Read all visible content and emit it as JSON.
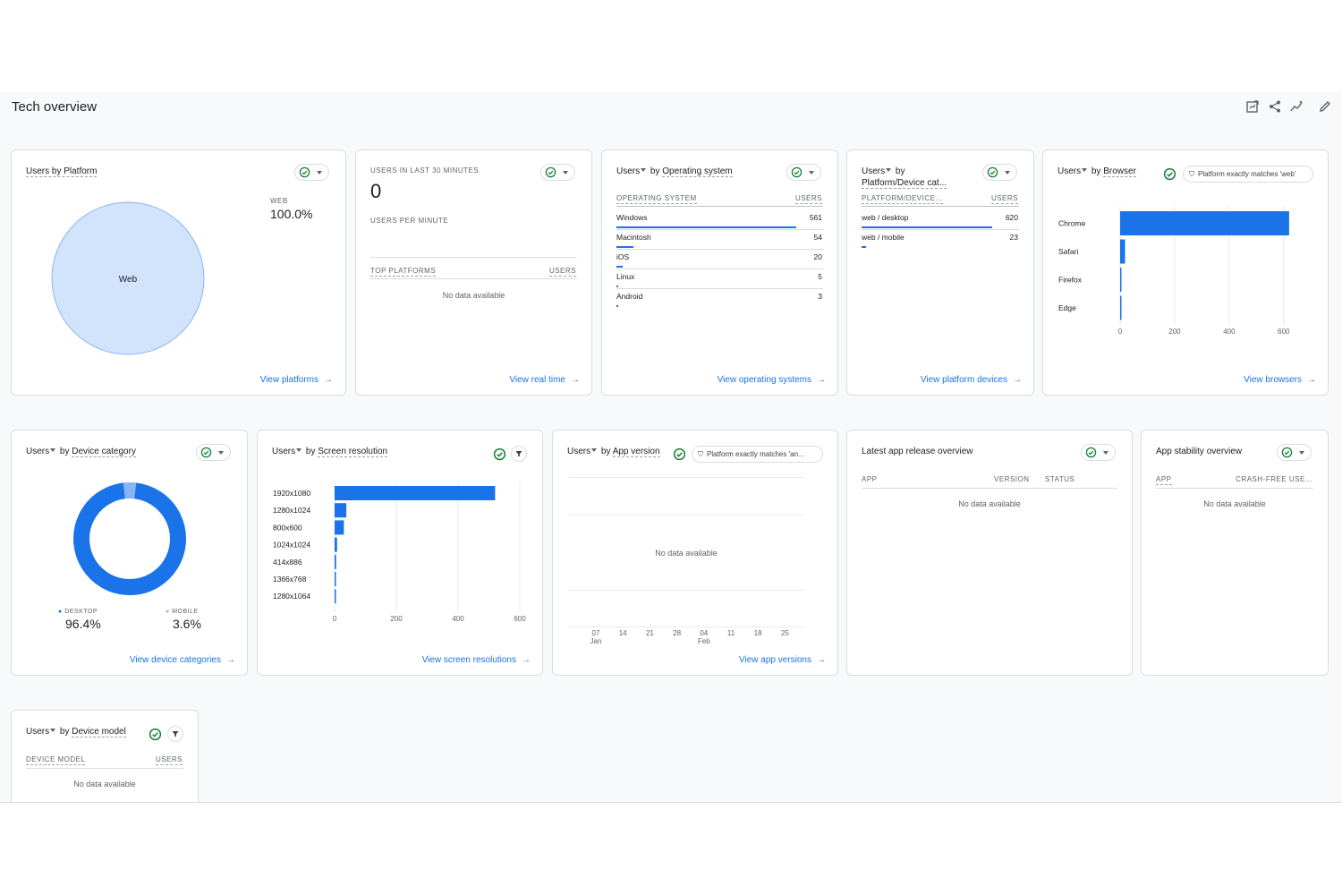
{
  "page": {
    "title": "Tech overview"
  },
  "toolbar": {
    "icons": [
      "edit-report-icon",
      "share-icon",
      "insights-icon",
      "pencil-icon"
    ]
  },
  "common": {
    "no_data": "No data available",
    "users_prefix": "Users",
    "by": "by"
  },
  "platform_card": {
    "dimension": "Users by Platform",
    "legend_label": "WEB",
    "legend_value": "100.0%",
    "pie_label": "Web",
    "link": "View platforms",
    "chart_data": {
      "type": "pie",
      "slices": [
        {
          "name": "Web",
          "value": 100.0
        }
      ],
      "colors": [
        "#d2e3fc"
      ]
    }
  },
  "realtime_card": {
    "title": "USERS IN LAST 30 MINUTES",
    "count": "0",
    "per_minute": "USERS PER MINUTE",
    "col1": "TOP PLATFORMS",
    "col2": "USERS",
    "link": "View real time"
  },
  "os_card": {
    "dimension": "Operating system",
    "col1": "OPERATING SYSTEM",
    "col2": "USERS",
    "link": "View operating systems",
    "rows": [
      {
        "label": "Windows",
        "value": "561",
        "n": 561
      },
      {
        "label": "Macintosh",
        "value": "54",
        "n": 54
      },
      {
        "label": "iOS",
        "value": "20",
        "n": 20
      },
      {
        "label": "Linux",
        "value": "5",
        "n": 5
      },
      {
        "label": "Android",
        "value": "3",
        "n": 3
      }
    ]
  },
  "platform_device_card": {
    "title_line1": "by",
    "title_line2": "Platform/Device cat...",
    "col1": "PLATFORM/DEVICE...",
    "col2": "USERS",
    "link": "View platform devices",
    "rows": [
      {
        "label": "web / desktop",
        "value": "620",
        "n": 620
      },
      {
        "label": "web / mobile",
        "value": "23",
        "n": 23
      }
    ]
  },
  "browser_card": {
    "dimension": "Browser",
    "filter": "Platform exactly matches 'web'",
    "link": "View browsers",
    "chart_data": {
      "type": "bar",
      "orientation": "horizontal",
      "categories": [
        "Chrome",
        "Safari",
        "Firefox",
        "Edge"
      ],
      "values": [
        620,
        18,
        3,
        2
      ],
      "xlim": [
        0,
        640
      ],
      "ticks": [
        "0",
        "200",
        "400",
        "600"
      ]
    }
  },
  "device_category_card": {
    "dimension": "Device category",
    "link": "View device categories",
    "legend": [
      {
        "label": "DESKTOP",
        "value": "96.4%"
      },
      {
        "label": "MOBILE",
        "value": "3.6%"
      }
    ],
    "chart_data": {
      "type": "pie",
      "donut": true,
      "slices": [
        {
          "name": "DESKTOP",
          "value": 96.4
        },
        {
          "name": "MOBILE",
          "value": 3.6
        }
      ],
      "colors": [
        "#1a73e8",
        "#8ab4f8"
      ]
    }
  },
  "screen_card": {
    "dimension": "Screen resolution",
    "link": "View screen resolutions",
    "chart_data": {
      "type": "bar",
      "orientation": "horizontal",
      "categories": [
        "1920x1080",
        "1280x1024",
        "800x600",
        "1024x1024",
        "414x886",
        "1366x768",
        "1280x1064"
      ],
      "values": [
        520,
        38,
        30,
        8,
        5,
        4,
        3
      ],
      "xlim": [
        0,
        600
      ],
      "ticks": [
        "0",
        "200",
        "400",
        "600"
      ]
    }
  },
  "app_version_card": {
    "dimension": "App version",
    "filter": "Platform exactly matches 'an...",
    "link": "View app versions",
    "x_ticks": [
      {
        "day": "07",
        "month": "Jan"
      },
      {
        "day": "14",
        "month": ""
      },
      {
        "day": "21",
        "month": ""
      },
      {
        "day": "28",
        "month": ""
      },
      {
        "day": "04",
        "month": "Feb"
      },
      {
        "day": "11",
        "month": ""
      },
      {
        "day": "18",
        "month": ""
      },
      {
        "day": "25",
        "month": ""
      }
    ]
  },
  "release_card": {
    "title": "Latest app release overview",
    "col1": "APP",
    "col2": "VERSION",
    "col3": "STATUS"
  },
  "stability_card": {
    "title": "App stability overview",
    "col1": "APP",
    "col2": "CRASH-FREE USE..."
  },
  "device_model_card": {
    "dimension": "Device model",
    "col1": "DEVICE MODEL",
    "col2": "USERS"
  },
  "colors": {
    "accent": "#1a73e8",
    "check": "#188038",
    "pie_fill": "#d2e3fc",
    "pie_stroke": "#8ab4f8"
  }
}
